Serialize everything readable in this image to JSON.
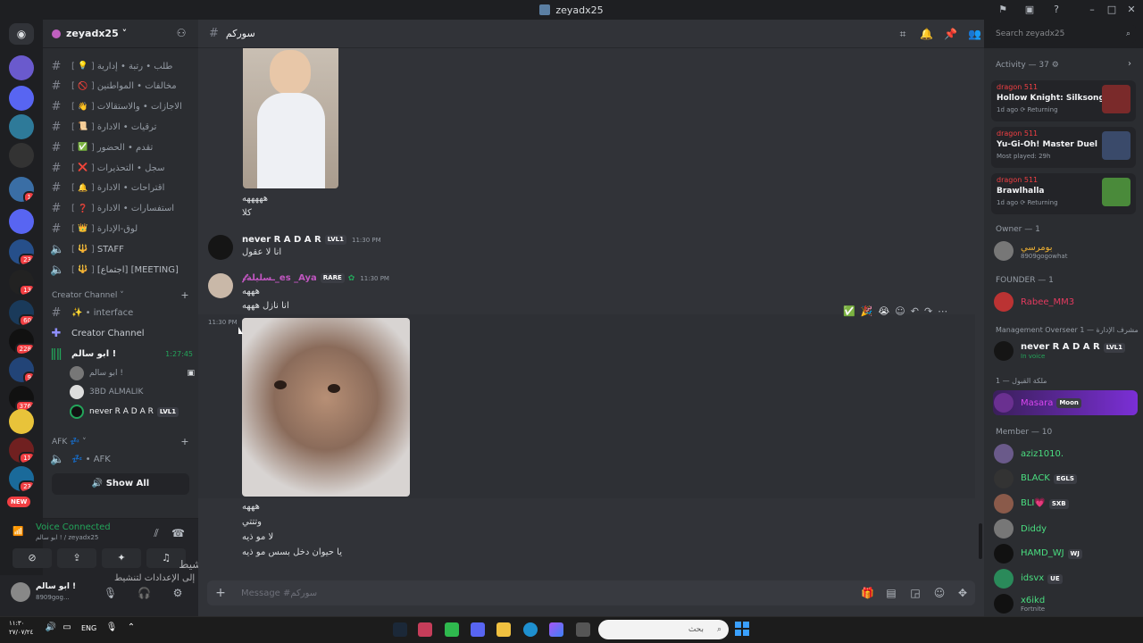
{
  "window": {
    "title": "zeyadx25"
  },
  "guild": {
    "name": "zeyadx25 ˅"
  },
  "servers": [
    {
      "badge": ""
    },
    {
      "badge": ""
    },
    {
      "badge": ""
    },
    {
      "badge": ""
    },
    {
      "badge": "1"
    },
    {
      "badge": ""
    },
    {
      "badge": "23"
    },
    {
      "badge": "13"
    },
    {
      "badge": "60"
    },
    {
      "badge": "228"
    },
    {
      "badge": "9"
    },
    {
      "badge": "376"
    },
    {
      "badge": ""
    },
    {
      "badge": "11"
    },
    {
      "badge": "23"
    }
  ],
  "servers_new": "NEW",
  "channels": [
    {
      "emoji": "💡",
      "name": "طلب • رتبة • إدارية",
      "color": "#f0b232"
    },
    {
      "emoji": "🚫",
      "name": "مخالفات • المواطنين",
      "color": "#f23f43"
    },
    {
      "emoji": "👋",
      "name": "الاجازات • والاستقالات",
      "color": "#f0b232"
    },
    {
      "emoji": "📜",
      "name": "ترقيات • الادارة",
      "color": "#e0a060"
    },
    {
      "emoji": "✅",
      "name": "تقدم • الحضور",
      "color": "#3ba55d"
    },
    {
      "emoji": "❌",
      "name": "سجل • التحذيرات",
      "color": "#f23f43"
    },
    {
      "emoji": "🔔",
      "name": "اقتراحات • الادارة",
      "color": "#f0b232"
    },
    {
      "emoji": "❓",
      "name": "استفسارات • الادارة",
      "color": "#f23f43"
    },
    {
      "emoji": "👑",
      "name": "لوق-الإدارة",
      "color": "#f0b232"
    },
    {
      "emoji": "🔱",
      "name": "STAFF",
      "color": "#f0b232"
    },
    {
      "emoji": "🔱",
      "name": "[اجتماع] [MEETING]",
      "color": "#f0b232"
    }
  ],
  "creator_category": "Creator Channel ˅",
  "creator_channels": [
    "✨ • interface",
    "Creator Channel"
  ],
  "voice_channel": {
    "name": "ابو سالم !",
    "timer": "1:27:45"
  },
  "voice_users": [
    "ابو سالم !",
    "3BD ALMALIK",
    "never R A D A R"
  ],
  "voice_user_tag": "LVL1",
  "afk_category": "AFK 💤 ˅",
  "afk_channel": "💤 • AFK",
  "show_all": "Show All",
  "voice_status": {
    "title": "Voice Connected",
    "sub": "ابو سالم ! / zeyadx25"
  },
  "user_panel": {
    "name": "ابو سالم !",
    "status": "8909gog..."
  },
  "activation": {
    "line1": "تنشيط Windows",
    "line2": "انتقل إلى الإعدادات لتنشيط Windows"
  },
  "channel_header": {
    "name": "سورکم"
  },
  "search": {
    "placeholder": "Search zeyadx25"
  },
  "messages": {
    "m0_line1": "هههههه",
    "m0_line2": "كلا",
    "m1": {
      "name": "never R A D A R",
      "tag": "LVL1",
      "time": "11:30 PM",
      "text": "انا لا عقول"
    },
    "m2": {
      "name": "𝓯ـسليلة_es _Aya",
      "tag": "RARE",
      "time": "11:30 PM",
      "line1": "هههه",
      "line2": "انا نازل هههه"
    },
    "m3_time": "11:30 PM",
    "m4": [
      "هههه",
      "وتتتي",
      "لا مو ذيه",
      "يا حيوان دخل بسس مو ذيه"
    ]
  },
  "composer": {
    "placeholder": "Message #سورکم"
  },
  "activity": {
    "header": "Activity — 37 ⚙",
    "items": [
      {
        "user": "dragon 511",
        "game": "Hollow Knight: Silksong",
        "status": "1d ago  ⟳ Returning"
      },
      {
        "user": "dragon 511",
        "game": "Yu-Gi-Oh! Master Duel",
        "status": "Most played: 29h"
      },
      {
        "user": "dragon 511",
        "game": "Brawlhalla",
        "status": "1d ago  ⟳ Returning"
      }
    ]
  },
  "member_groups": {
    "owner": "Owner — 1",
    "owner_name": "بومرسي",
    "owner_status": "8909gogowhat",
    "founder": "FOUNDER — 1",
    "founder_name": "Rabee_MM3",
    "mgmt": "Management Overseer مشرف الإدارة — 1",
    "mgmt_name": "never R A D A R",
    "mgmt_tag": "LVL1",
    "mgmt_status": "In voice",
    "queen": "ملكة القبول — 1",
    "queen_name": "Masara",
    "queen_tag": "Moon",
    "member": "Member — 10",
    "members": [
      {
        "name": "aziz1010.",
        "tag": ""
      },
      {
        "name": "BLACK",
        "tag": "EGLS"
      },
      {
        "name": "BLI💗",
        "tag": "SXB"
      },
      {
        "name": "Diddy",
        "tag": ""
      },
      {
        "name": "HAMD_WJ",
        "tag": "WJ"
      },
      {
        "name": "idsvx",
        "tag": "UE"
      },
      {
        "name": "x6ikd",
        "tag": "",
        "status": "Fortnite"
      }
    ]
  },
  "taskbar": {
    "time": "١١:٣٠",
    "date": "٢٧/٠٧/٢٤",
    "lang": "ENG",
    "search": "بحث"
  },
  "colors": {
    "bg": "#313338",
    "sidebar": "#2b2d31",
    "accent": "#5865f2",
    "green": "#23a55a"
  }
}
